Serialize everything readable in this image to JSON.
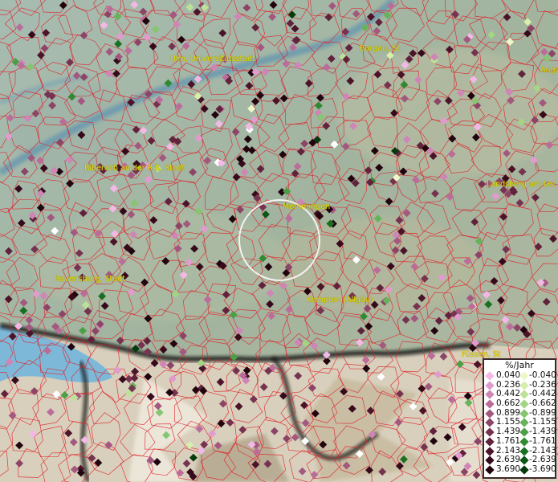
{
  "map": {
    "cities": [
      {
        "id": "ulm",
        "label": "Ulm, Universitätsstadt"
      },
      {
        "id": "burgau",
        "label": "Burgau, St"
      },
      {
        "id": "augsburg",
        "label": "Augs"
      },
      {
        "id": "biberach",
        "label": "Biberach an der Riß, Stadt"
      },
      {
        "id": "memmingen",
        "label": "Memmingen"
      },
      {
        "id": "landsberg",
        "label": "Landsberg am Lec"
      },
      {
        "id": "ravensburg",
        "label": "Ravensburg, Stadt"
      },
      {
        "id": "kempten",
        "label": "Kempten (Allgäu)"
      },
      {
        "id": "fuessen",
        "label": "Füssen, St"
      }
    ],
    "highlight": "circle-around-memmingen"
  },
  "legend": {
    "title": "%/Jahr",
    "rows": [
      {
        "pos": "0.040",
        "neg": "-0.040",
        "pos_color": "#f2b8e6",
        "neg_color": "#eef7c8"
      },
      {
        "pos": "0.236",
        "neg": "-0.236",
        "pos_color": "#e09cce",
        "neg_color": "#d6efac"
      },
      {
        "pos": "0.442",
        "neg": "-0.442",
        "pos_color": "#cf86b6",
        "neg_color": "#bde297"
      },
      {
        "pos": "0.662",
        "neg": "-0.662",
        "pos_color": "#bb6d9a",
        "neg_color": "#a3d585"
      },
      {
        "pos": "0.899",
        "neg": "-0.899",
        "pos_color": "#a3587f",
        "neg_color": "#86c571"
      },
      {
        "pos": "1.155",
        "neg": "-1.155",
        "pos_color": "#8c4566",
        "neg_color": "#66b35a"
      },
      {
        "pos": "1.439",
        "neg": "-1.439",
        "pos_color": "#763350",
        "neg_color": "#4c9f46"
      },
      {
        "pos": "1.761",
        "neg": "-1.761",
        "pos_color": "#61223c",
        "neg_color": "#2f8a32"
      },
      {
        "pos": "2.143",
        "neg": "-2.143",
        "pos_color": "#4b1429",
        "neg_color": "#1a7022"
      },
      {
        "pos": "2.639",
        "neg": "-2.639",
        "pos_color": "#360a1b",
        "neg_color": "#0d5716"
      },
      {
        "pos": "3.690",
        "neg": "-3.690",
        "pos_color": "#22040f",
        "neg_color": "#053a0b"
      }
    ]
  }
}
